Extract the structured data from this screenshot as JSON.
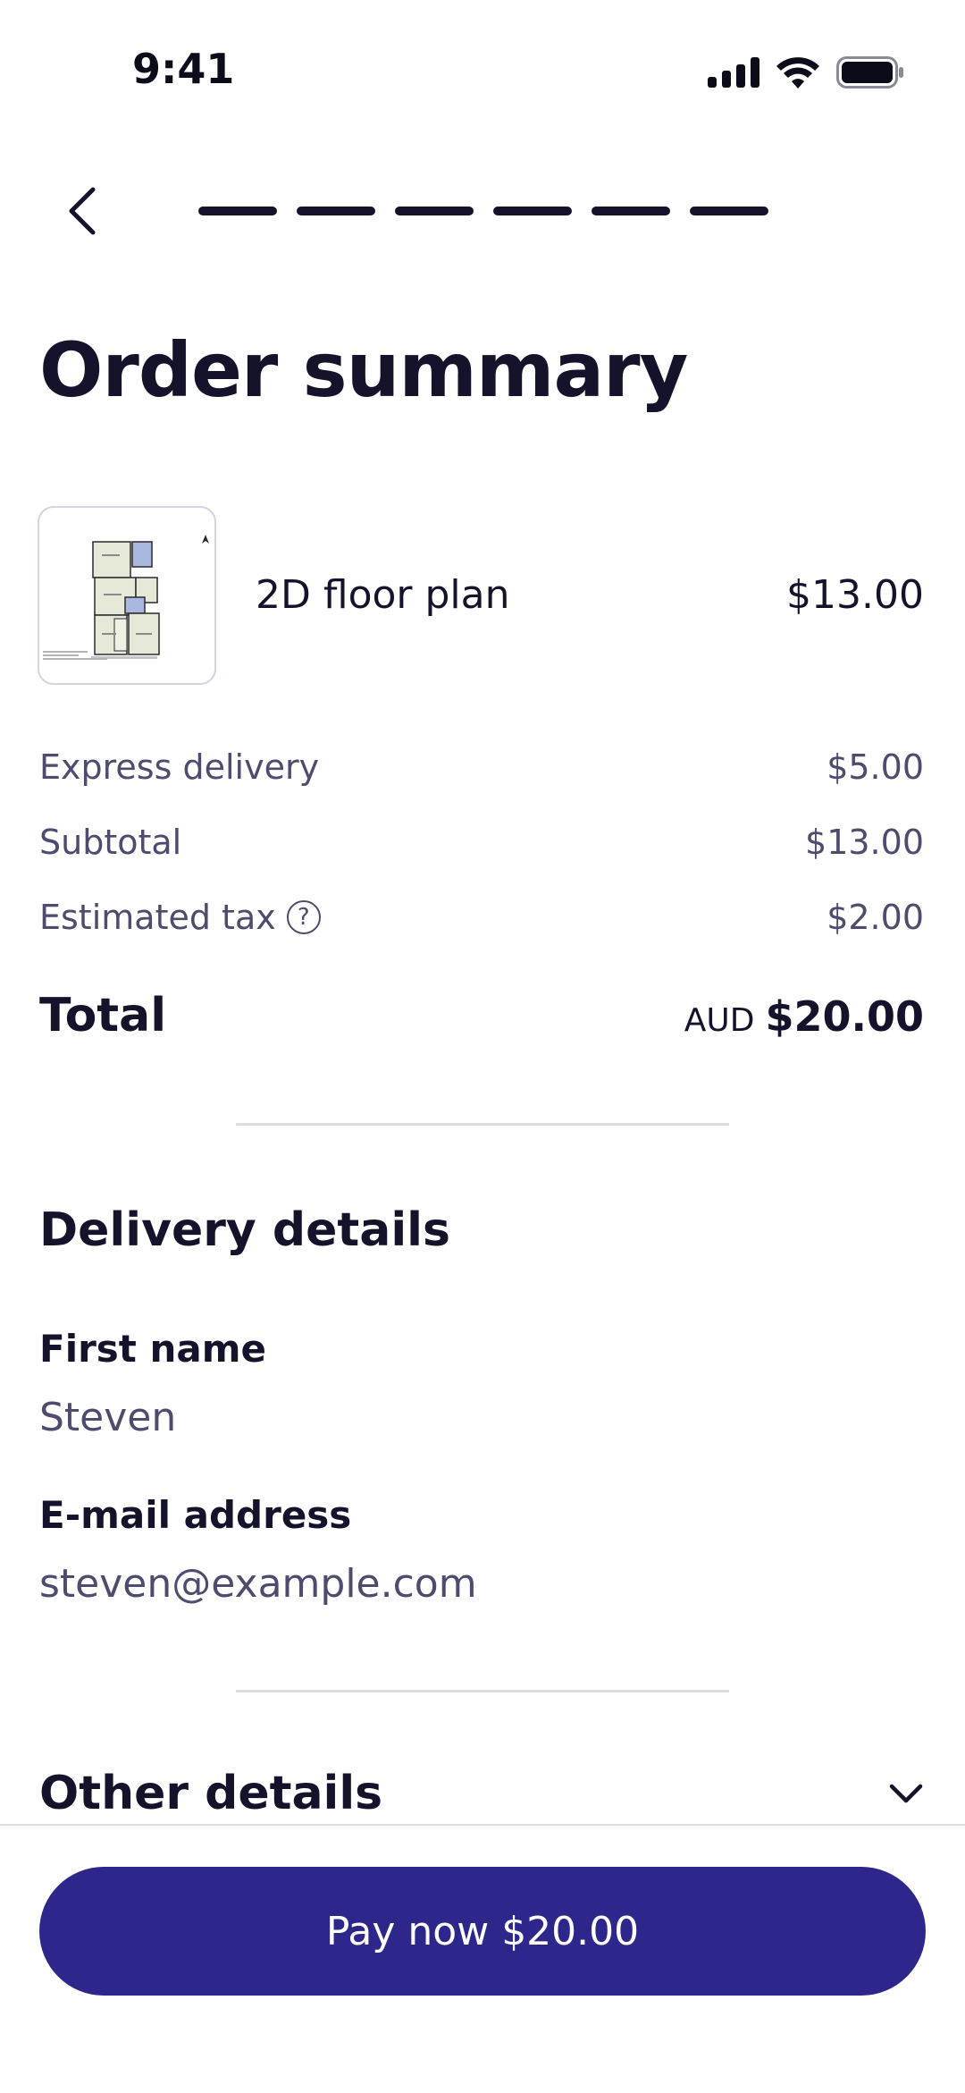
{
  "status_bar": {
    "time": "9:41"
  },
  "header": {
    "back_icon": "chevron-left-icon",
    "progress_steps": 6
  },
  "page": {
    "title": "Order summary"
  },
  "product": {
    "name": "2D floor plan",
    "price": "$13.00",
    "thumbnail_icon": "floor-plan-thumbnail"
  },
  "summary": {
    "express_delivery_label": "Express delivery",
    "express_delivery_value": "$5.00",
    "subtotal_label": "Subtotal",
    "subtotal_value": "$13.00",
    "tax_label": "Estimated tax",
    "tax_value": "$2.00",
    "tax_help_icon": "question-circle-icon",
    "total_label": "Total",
    "total_currency": "AUD",
    "total_amount": "$20.00"
  },
  "delivery": {
    "section_title": "Delivery details",
    "first_name_label": "First name",
    "first_name_value": "Steven",
    "email_label": "E-mail address",
    "email_value": "steven@example.com"
  },
  "other_details": {
    "title": "Other details",
    "icon": "chevron-down-icon"
  },
  "footer": {
    "pay_label": "Pay now",
    "pay_amount": "$20.00",
    "accent_color": "#2e278b"
  }
}
